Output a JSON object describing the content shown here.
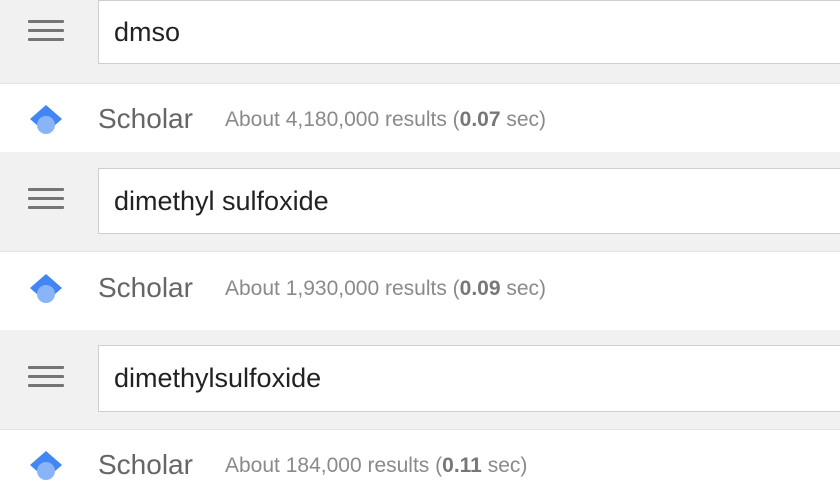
{
  "blocks": [
    {
      "query": "dmso",
      "scholar_label": "Scholar",
      "stats_prefix": "About 4,180,000 results (",
      "time": "0.07",
      "stats_suffix": " sec)"
    },
    {
      "query": "dimethyl sulfoxide",
      "scholar_label": "Scholar",
      "stats_prefix": "About 1,930,000 results (",
      "time": "0.09",
      "stats_suffix": " sec)"
    },
    {
      "query": "dimethylsulfoxide",
      "scholar_label": "Scholar",
      "stats_prefix": "About 184,000 results (",
      "time": "0.11",
      "stats_suffix": " sec)"
    }
  ],
  "icons": {
    "menu": "menu-icon",
    "scholar_logo": "scholar-logo-icon"
  },
  "colors": {
    "bar_background": "#f1f1f1",
    "logo_dark_blue": "#4285f4",
    "logo_light_blue": "#8ab4f8"
  }
}
